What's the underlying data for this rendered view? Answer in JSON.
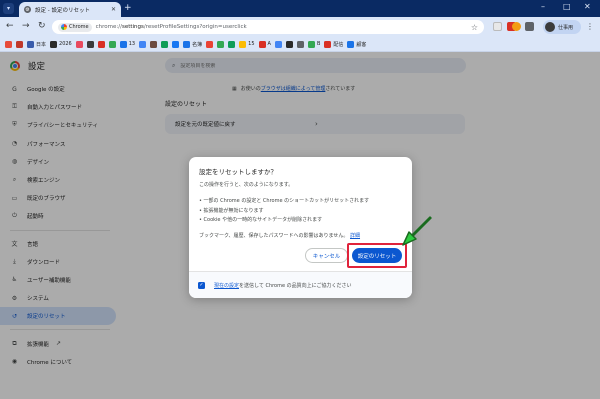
{
  "window": {
    "tab_title": "設定 - 設定のリセット",
    "new_tab_glyph": "+",
    "controls": [
      "–",
      "□",
      "✕"
    ]
  },
  "toolbar": {
    "chip_label": "Chrome",
    "url_host": "chrome://",
    "url_path": "settings",
    "url_rest": "/resetProfileSettings?origin=userclick",
    "profile_name": "仕事用",
    "icons": {
      "back": "arrow-left-icon",
      "forward": "arrow-right-icon",
      "reload": "reload-icon",
      "star": "star-icon",
      "menu": "more-vert-icon"
    }
  },
  "bookmarks": [
    {
      "color": "#e74c3c",
      "label": ""
    },
    {
      "color": "#c0392b",
      "label": ""
    },
    {
      "color": "#3a5cab",
      "label": "日本"
    },
    {
      "color": "#2b2b2b",
      "label": "2026"
    },
    {
      "color": "#e84a5f",
      "label": ""
    },
    {
      "color": "#3b3b3b",
      "label": ""
    },
    {
      "color": "#d93025",
      "label": ""
    },
    {
      "color": "#34a853",
      "label": ""
    },
    {
      "color": "#1a73e8",
      "label": "13"
    },
    {
      "color": "#4285f4",
      "label": ""
    },
    {
      "color": "#6d4c41",
      "label": ""
    },
    {
      "color": "#0f9d58",
      "label": ""
    },
    {
      "color": "#1877f2",
      "label": ""
    },
    {
      "color": "#1a73e8",
      "label": "名簿"
    },
    {
      "color": "#ea4335",
      "label": ""
    },
    {
      "color": "#34a853",
      "label": ""
    },
    {
      "color": "#0f9d58",
      "label": ""
    },
    {
      "color": "#fbbc05",
      "label": "15"
    },
    {
      "color": "#d93025",
      "label": "A"
    },
    {
      "color": "#4285f4",
      "label": ""
    },
    {
      "color": "#2b2b2b",
      "label": ""
    },
    {
      "color": "#5f6368",
      "label": ""
    },
    {
      "color": "#34a853",
      "label": "B"
    },
    {
      "color": "#d93025",
      "label": "配信"
    },
    {
      "color": "#1a73e8",
      "label": "顧客"
    }
  ],
  "settings": {
    "brand": "設定",
    "search_placeholder": "設定項目を検索",
    "managed_note_prefix": "お使いの",
    "managed_note_link": "ブラウザは組織によって管理",
    "managed_note_suffix": "されています",
    "section_title": "設定のリセット",
    "card_label": "設定を元の既定値に戻す",
    "sidebar": [
      {
        "label": "Google の設定",
        "icon": "google-icon",
        "glyph": "G"
      },
      {
        "label": "自動入力とパスワード",
        "icon": "key-icon",
        "glyph": "⚿"
      },
      {
        "label": "プライバシーとセキュリティ",
        "icon": "shield-icon",
        "glyph": "⛨"
      },
      {
        "label": "パフォーマンス",
        "icon": "speedometer-icon",
        "glyph": "◔"
      },
      {
        "label": "デザイン",
        "icon": "palette-icon",
        "glyph": "◍"
      },
      {
        "label": "検索エンジン",
        "icon": "search-icon",
        "glyph": "⌕"
      },
      {
        "label": "既定のブラウザ",
        "icon": "browser-icon",
        "glyph": "▭"
      },
      {
        "label": "起動時",
        "icon": "power-icon",
        "glyph": "⏻"
      },
      {
        "label": "言語",
        "icon": "translate-icon",
        "glyph": "文"
      },
      {
        "label": "ダウンロード",
        "icon": "download-icon",
        "glyph": "⤓"
      },
      {
        "label": "ユーザー補助機能",
        "icon": "accessibility-icon",
        "glyph": "♿"
      },
      {
        "label": "システム",
        "icon": "wrench-icon",
        "glyph": "⚙"
      },
      {
        "label": "設定のリセット",
        "icon": "reset-icon",
        "glyph": "↺"
      }
    ],
    "extensions_label": "拡張機能",
    "about_label": "Chrome について"
  },
  "dialog": {
    "title": "設定をリセットしますか？",
    "intro": "この操作を行うと、次のようになります。",
    "bullets": [
      "• 一部の Chrome の設定と Chrome のショートカットがリセットされます",
      "• 拡張機能が無効になります",
      "• Cookie や他の一時的なサイトデータが削除されます"
    ],
    "note": "ブックマーク、履歴、保存したパスワードへの影響はありません。",
    "details_link": "詳細",
    "cancel_label": "キャンセル",
    "reset_label": "設定のリセット",
    "footer_link": "現在の設定",
    "footer_text": "を送信して Chrome の品質向上にご協力ください",
    "checkbox_checked": true
  },
  "colors": {
    "accent": "#0b57d0",
    "highlight": "#e0233b",
    "arrow": "#2ecc40"
  }
}
